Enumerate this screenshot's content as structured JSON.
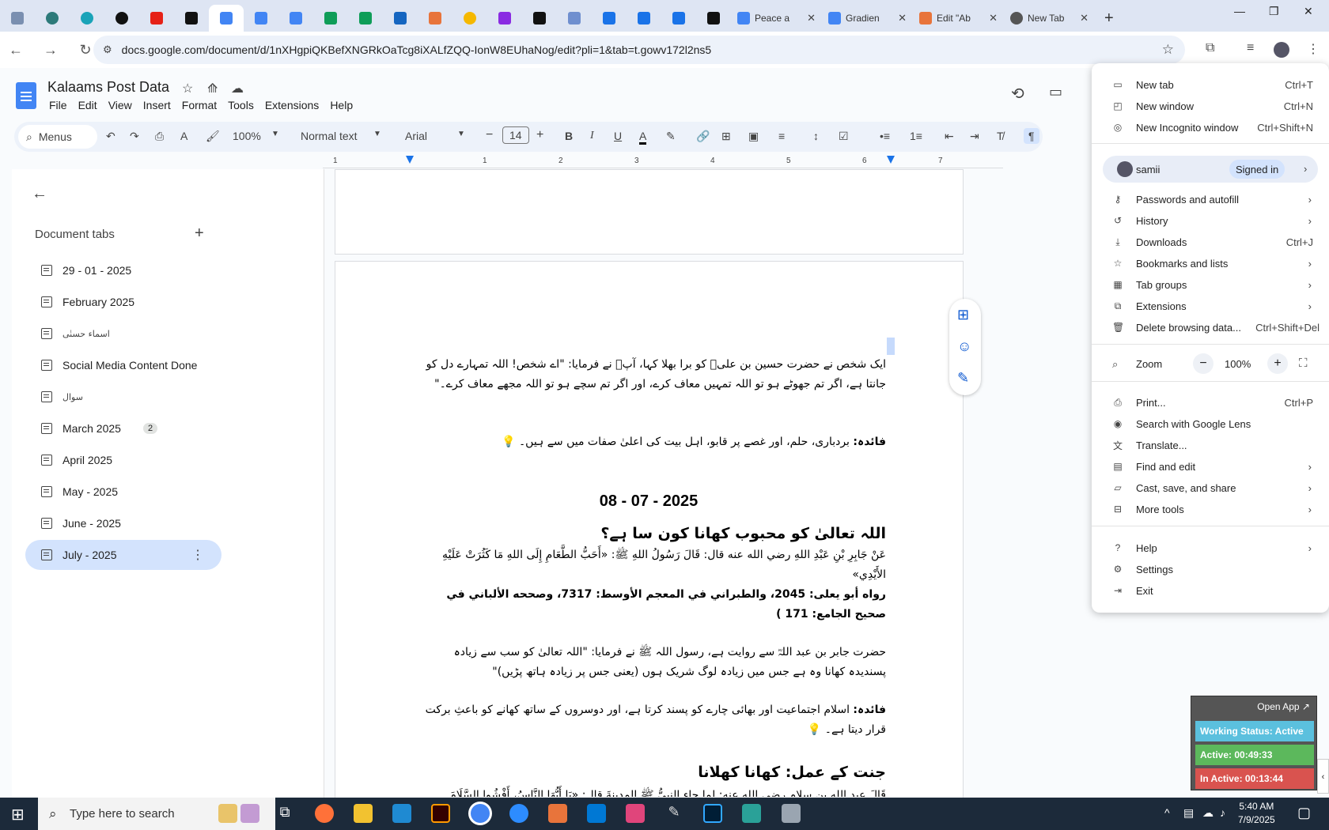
{
  "browser": {
    "tabs": [
      {
        "title": "Peace a",
        "kind": "docs"
      },
      {
        "title": "Gradien",
        "kind": "docs"
      },
      {
        "title": "Edit \"Ab",
        "kind": "orange"
      },
      {
        "title": "New Tab",
        "kind": "chrome"
      }
    ],
    "url": "docs.google.com/document/d/1nXHgpiQKBefXNGRkOaTcg8iXALfZQQ-IonW8EUhaNog/edit?pli=1&tab=t.gowv172l2ns5"
  },
  "docs": {
    "title": "Kalaams Post Data",
    "menu": [
      "File",
      "Edit",
      "View",
      "Insert",
      "Format",
      "Tools",
      "Extensions",
      "Help"
    ],
    "toolbar": {
      "search": "Menus",
      "zoom": "100%",
      "style": "Normal text",
      "font": "Arial",
      "size": "14",
      "bold": "B",
      "italic": "I",
      "underline": "U",
      "textcolor": "A"
    },
    "ruler": [
      "1",
      "1",
      "2",
      "3",
      "4",
      "5",
      "6",
      "7"
    ]
  },
  "panel": {
    "title": "Document tabs",
    "tabs": [
      {
        "label": "29 - 01 - 2025"
      },
      {
        "label": "February 2025"
      },
      {
        "label": "اسماء حسنٰی"
      },
      {
        "label": "Social Media Content Done"
      },
      {
        "label": "سوال"
      },
      {
        "label": "March 2025",
        "badge": "2"
      },
      {
        "label": "April 2025"
      },
      {
        "label": "May - 2025"
      },
      {
        "label": "June - 2025"
      },
      {
        "label": "July - 2025"
      }
    ]
  },
  "document": {
    "p1": "ایک شخص نے حضرت حسین بن علیؓ کو برا بھلا کہا، آپؓ نے فرمایا: \"اے شخص! اللہ تمہارے دل کو جانتا ہے، اگر تم جھوٹے ہو تو اللہ تمہیں معاف کرے، اور اگر تم سچے ہو تو اللہ مجھے معاف کرے۔\"",
    "f1_label": "فائدہ:",
    "f1": " بردباری، حلم، اور غصے پر قابو، اہل بیت کی اعلیٰ صفات میں سے ہیں۔ 💡",
    "date": "08 - 07 - 2025",
    "h1": "اللہ تعالیٰ کو محبوب کھانا کون سا ہے؟",
    "arabic1": "عَنْ جَابِرِ بْنِ عَبْدِ اللهِ رضي الله عنه قال: قَالَ رَسُولُ اللهِ ﷺ: «أَحَبُّ الطَّعَامِ إِلَى اللهِ مَا كَثُرَتْ عَلَيْهِ الأَيْدِي»",
    "ref1": "رواه أبو يعلى: 2045، والطبراني في المعجم الأوسط: 7317، وصححه الألباني في صحيح الجامع: 171 )",
    "p2": "حضرت جابر بن عبد اللہؓ سے روایت ہے، رسول اللہ ﷺ نے فرمایا: \"اللہ تعالیٰ کو سب سے زیادہ پسندیدہ کھانا وہ ہے جس میں زیادہ لوگ شریک ہوں (یعنی جس پر زیادہ ہاتھ پڑیں)\"",
    "f2_label": "فائدہ:",
    "f2": " اسلام اجتماعیت اور بھائی چارے کو پسند کرتا ہے، اور دوسروں کے ساتھ کھانے کو باعثِ برکت قرار دیتا ہے۔ 💡",
    "h2": "جنت کے عمل: کھانا کھلانا",
    "arabic2": "قَالَ عبد الله بن سلام رضي الله عنه: لما جاء النبيُّ ﷺ المدينةَ قال: «يَا أَيُّهَا النَّاسُ، أَفْشُوا السَّلَامَ"
  },
  "chrome_menu": {
    "items": [
      {
        "label": "New tab",
        "shortcut": "Ctrl+T",
        "icon": "new-tab-icon"
      },
      {
        "label": "New window",
        "shortcut": "Ctrl+N",
        "icon": "new-window-icon"
      },
      {
        "label": "New Incognito window",
        "shortcut": "Ctrl+Shift+N",
        "icon": "incognito-icon"
      },
      {
        "label": "Passwords and autofill",
        "icon": "key-icon"
      },
      {
        "label": "History",
        "icon": "history-icon"
      },
      {
        "label": "Downloads",
        "shortcut": "Ctrl+J",
        "icon": "download-icon"
      },
      {
        "label": "Bookmarks and lists",
        "icon": "star-icon"
      },
      {
        "label": "Tab groups",
        "icon": "tab-groups-icon"
      },
      {
        "label": "Extensions",
        "icon": "puzzle-icon"
      },
      {
        "label": "Delete browsing data...",
        "shortcut": "Ctrl+Shift+Del",
        "icon": "trash-icon"
      },
      {
        "label": "Print...",
        "shortcut": "Ctrl+P",
        "icon": "print-icon"
      },
      {
        "label": "Search with Google Lens",
        "icon": "lens-icon"
      },
      {
        "label": "Translate...",
        "icon": "translate-icon"
      },
      {
        "label": "Find and edit",
        "icon": "find-icon"
      },
      {
        "label": "Cast, save, and share",
        "icon": "cast-icon"
      },
      {
        "label": "More tools",
        "icon": "tools-icon"
      },
      {
        "label": "Help",
        "icon": "help-icon"
      },
      {
        "label": "Settings",
        "icon": "settings-icon"
      },
      {
        "label": "Exit",
        "icon": "exit-icon"
      }
    ],
    "profile": {
      "name": "samii",
      "status": "Signed in"
    },
    "zoom": {
      "label": "Zoom",
      "value": "100%",
      "minus": "−",
      "plus": "+"
    }
  },
  "widget": {
    "open": "Open App ↗",
    "status": "Working Status: Active",
    "active": "Active: 00:49:33",
    "inactive": "In Active: 00:13:44"
  },
  "taskbar": {
    "search": "Type here to search",
    "time": "5:40 AM",
    "date": "7/9/2025"
  }
}
